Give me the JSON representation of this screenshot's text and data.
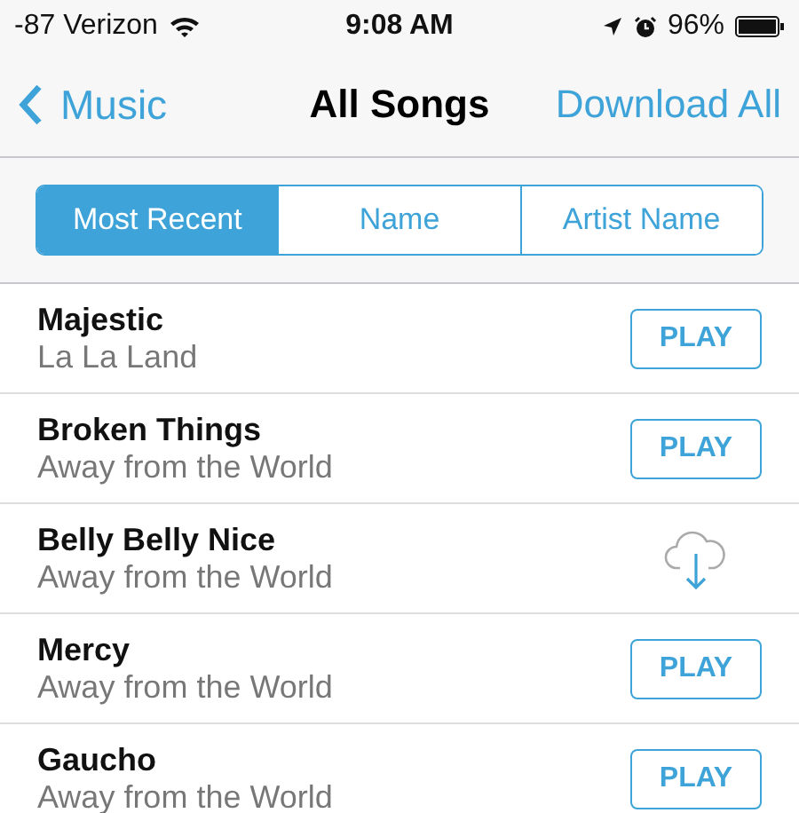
{
  "status_bar": {
    "carrier": "-87 Verizon",
    "time": "9:08 AM",
    "battery": "96%"
  },
  "nav": {
    "back": "Music",
    "title": "All Songs",
    "action": "Download All"
  },
  "segments": [
    {
      "label": "Most Recent",
      "selected": true
    },
    {
      "label": "Name",
      "selected": false
    },
    {
      "label": "Artist Name",
      "selected": false
    }
  ],
  "songs": [
    {
      "title": "Majestic",
      "artist": "La La Land",
      "kind": "play",
      "button": "PLAY"
    },
    {
      "title": "Broken Things",
      "artist": "Away from the World",
      "kind": "play",
      "button": "PLAY"
    },
    {
      "title": "Belly Belly Nice",
      "artist": "Away from the World",
      "kind": "download"
    },
    {
      "title": "Mercy",
      "artist": "Away from the World",
      "kind": "play",
      "button": "PLAY"
    },
    {
      "title": "Gaucho",
      "artist": "Away from the World",
      "kind": "play",
      "button": "PLAY"
    }
  ]
}
